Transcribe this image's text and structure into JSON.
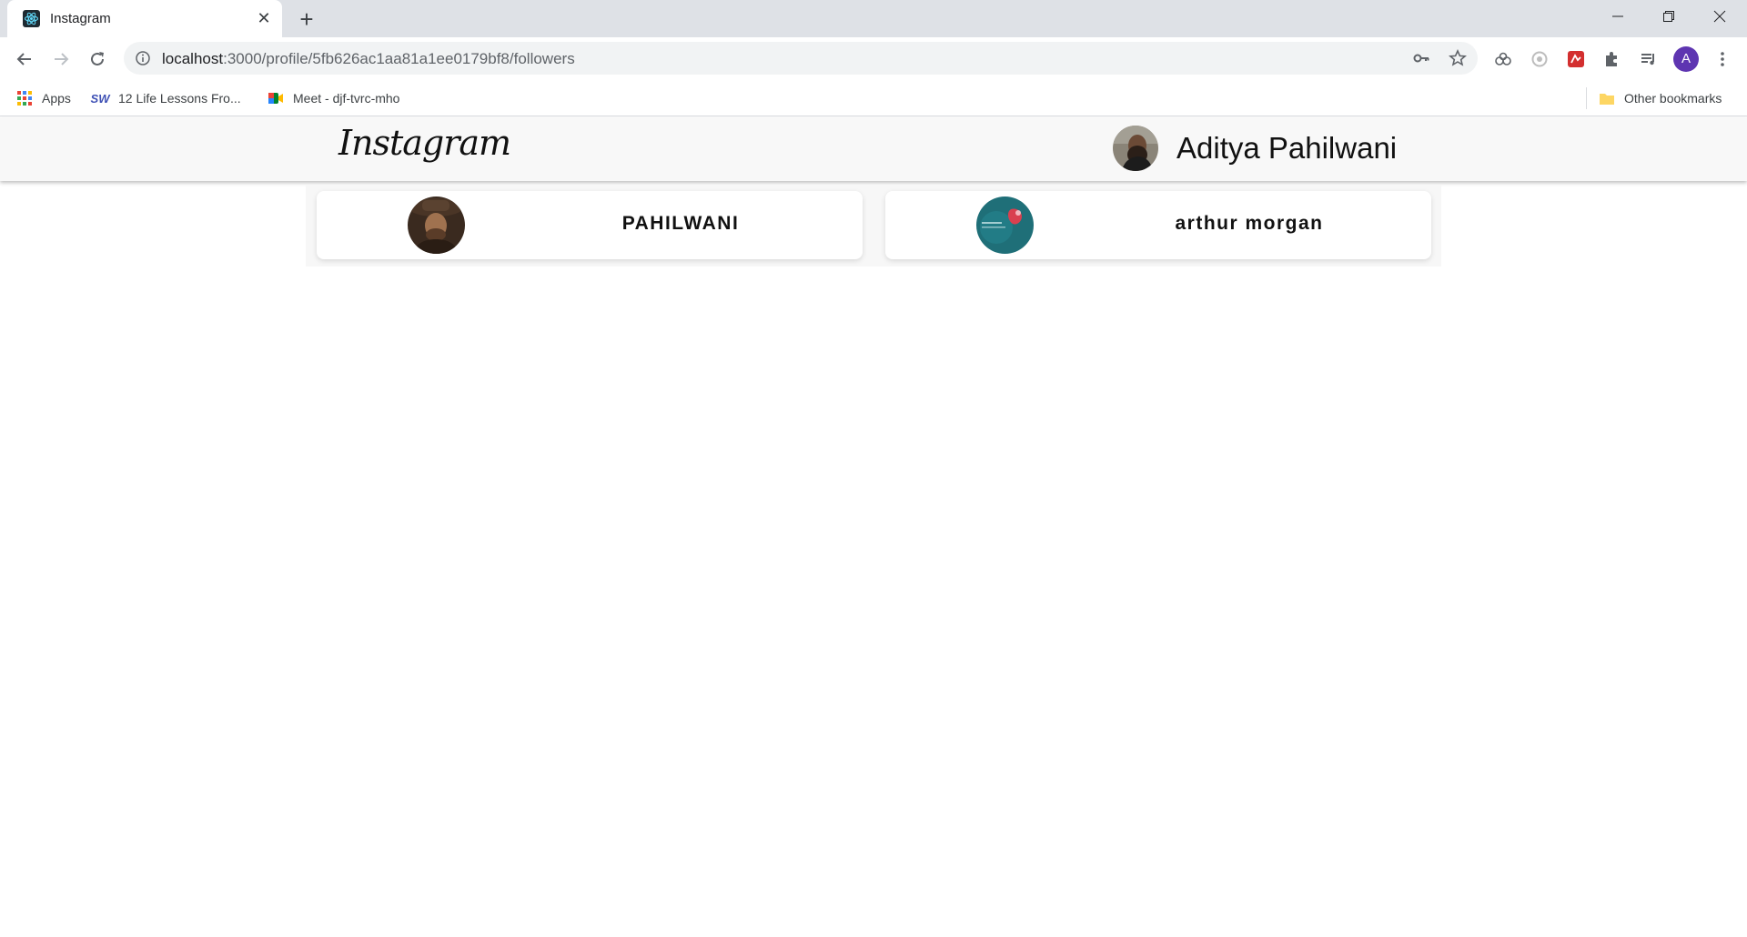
{
  "browser": {
    "tab": {
      "title": "Instagram",
      "favicon": "react-icon"
    },
    "url": {
      "host": "localhost",
      "path": ":3000/profile/5fb626ac1aa81a1ee0179bf8/followers"
    },
    "profile_initial": "A",
    "bookmarks": [
      {
        "label": "Apps",
        "icon": "apps-grid-icon"
      },
      {
        "label": "12 Life Lessons Fro...",
        "icon": "sw-icon"
      },
      {
        "label": "Meet - djf-tvrc-mho",
        "icon": "meet-icon"
      }
    ],
    "other_bookmarks": "Other bookmarks"
  },
  "app": {
    "brand": "Instagram",
    "current_user": "Aditya Pahilwani",
    "followers": [
      {
        "name": "PAHILWANI",
        "avatar": "cowboy-avatar"
      },
      {
        "name": "arthur morgan",
        "avatar": "teal-avatar"
      }
    ]
  },
  "colors": {
    "tabstrip": "#dee1e6",
    "navbar": "#f8f8f8",
    "profile_badge": "#5e35b1"
  }
}
